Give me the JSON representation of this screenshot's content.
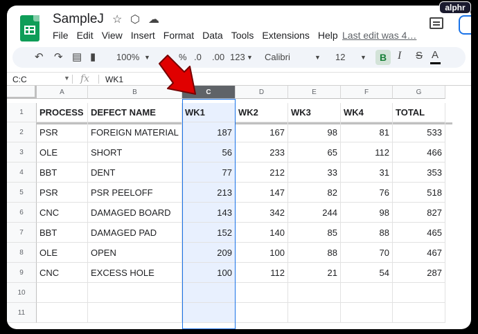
{
  "badge": "alphr",
  "doc": {
    "title": "SampleJ",
    "menu": [
      "File",
      "Edit",
      "View",
      "Insert",
      "Format",
      "Data",
      "Tools",
      "Extensions",
      "Help"
    ],
    "last_edit": "Last edit was 4…"
  },
  "toolbar": {
    "zoom": "100%",
    "percent": "%",
    "dec_less": ".0",
    "dec_more": ".00",
    "number_format": "123",
    "font": "Calibri",
    "font_size": "12",
    "bold": "B",
    "italic": "I",
    "strike": "S",
    "text_color": "A"
  },
  "formula_bar": {
    "cell_ref": "C:C",
    "fx": "fx",
    "value": "WK1"
  },
  "grid": {
    "columns": [
      "A",
      "B",
      "C",
      "D",
      "E",
      "F",
      "G"
    ],
    "selected_column": "C",
    "row_numbers": [
      "1",
      "2",
      "3",
      "4",
      "5",
      "6",
      "7",
      "8",
      "9",
      "10",
      "11"
    ],
    "rows": [
      [
        "PROCESS",
        "DEFECT NAME",
        "WK1",
        "WK2",
        "WK3",
        "WK4",
        "TOTAL"
      ],
      [
        "PSR",
        "FOREIGN MATERIAL",
        "187",
        "167",
        "98",
        "81",
        "533"
      ],
      [
        "OLE",
        "SHORT",
        "56",
        "233",
        "65",
        "112",
        "466"
      ],
      [
        "BBT",
        "DENT",
        "77",
        "212",
        "33",
        "31",
        "353"
      ],
      [
        "PSR",
        "PSR PEELOFF",
        "213",
        "147",
        "82",
        "76",
        "518"
      ],
      [
        "CNC",
        "DAMAGED BOARD",
        "143",
        "342",
        "244",
        "98",
        "827"
      ],
      [
        "BBT",
        "DAMAGED PAD",
        "152",
        "140",
        "85",
        "88",
        "465"
      ],
      [
        "OLE",
        "OPEN",
        "209",
        "100",
        "88",
        "70",
        "467"
      ],
      [
        "CNC",
        "EXCESS HOLE",
        "100",
        "112",
        "21",
        "54",
        "287"
      ],
      [
        "",
        "",
        "",
        "",
        "",
        "",
        ""
      ],
      [
        "",
        "",
        "",
        "",
        "",
        "",
        ""
      ]
    ]
  },
  "colors": {
    "sheets_green": "#0f9d58",
    "selected_header": "#5f6368",
    "selected_fill": "#e8f0fe",
    "selection_border": "#1a73e8",
    "arrow_red": "#e00000"
  }
}
